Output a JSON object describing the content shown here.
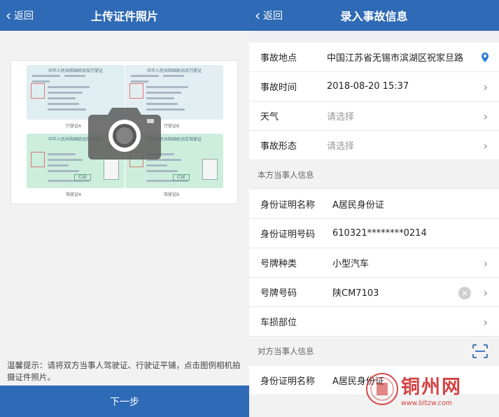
{
  "left": {
    "nav": {
      "back": "返回",
      "title": "上传证件照片"
    },
    "cards": {
      "card1_title": "中华人民共和国机动车行驶证",
      "card2_title": "中华人民共和国机动车行驶证",
      "card3_title": "中华人民共和国机动车驾驶证",
      "card4_title": "中华人民共和国机动车驾驶证",
      "label1": "行驶证A",
      "label2": "行驶证B",
      "label3": "驾驶证A",
      "label4": "驾驶证B",
      "class1": "C1E",
      "class2": "C1E"
    },
    "tip": "温馨提示：请将双方当事人驾驶证、行驶证平铺，点击图例相机拍摄证件照片。",
    "next": "下一步"
  },
  "right": {
    "nav": {
      "back": "返回",
      "title": "录入事故信息"
    },
    "accident": [
      {
        "label": "事故地点",
        "value": "中国江苏省无锡市滨湖区祝家旦路"
      },
      {
        "label": "事故时间",
        "value": "2018-08-20 15:37"
      },
      {
        "label": "天气",
        "value": "请选择"
      },
      {
        "label": "事故形态",
        "value": "请选择"
      }
    ],
    "section_self": "本方当事人信息",
    "self": [
      {
        "label": "身份证明名称",
        "value": "A居民身份证"
      },
      {
        "label": "身份证明号码",
        "value": "610321********0214"
      },
      {
        "label": "号牌种类",
        "value": "小型汽车"
      },
      {
        "label": "号牌号码",
        "value": "陕CM7103"
      },
      {
        "label": "车损部位",
        "value": ""
      }
    ],
    "section_other": "对方当事人信息",
    "other": [
      {
        "label": "身份证明名称",
        "value": "A居民身份证"
      }
    ]
  },
  "watermark": {
    "text": "铜州网",
    "url": "www.bltzw.com"
  },
  "colors": {
    "brand": "#2e6ab5",
    "pin": "#2e7fd6"
  }
}
